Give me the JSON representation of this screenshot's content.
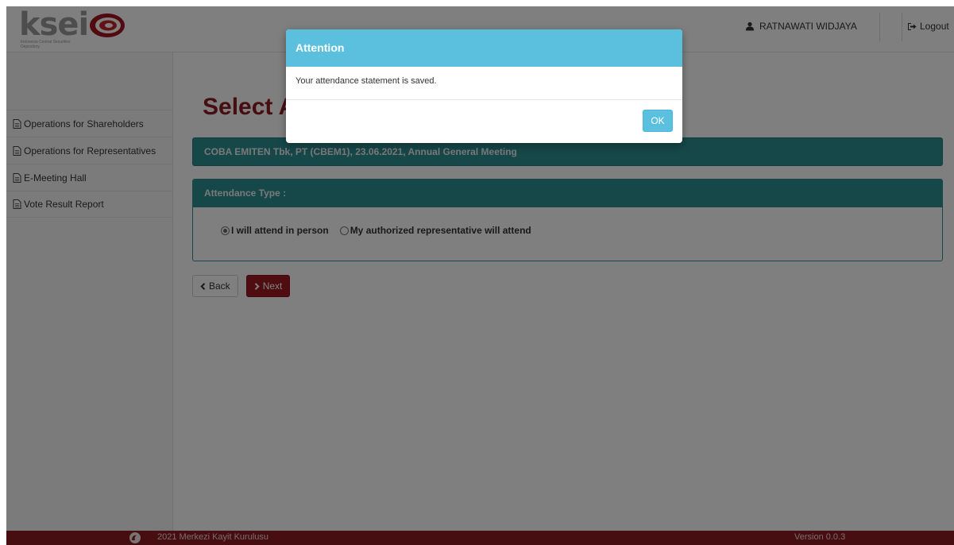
{
  "header": {
    "logo_text": "ksei",
    "logo_subtitle": "Indonesia Central Securities Depository",
    "user_name": "RATNAWATI WIDJAYA",
    "logout_label": "Logout"
  },
  "sidebar": {
    "items": [
      {
        "label": "Operations for Shareholders",
        "icon": "document-icon"
      },
      {
        "label": "Operations for Representatives",
        "icon": "document-icon"
      },
      {
        "label": "E-Meeting Hall",
        "icon": "document-icon"
      },
      {
        "label": "Vote Result Report",
        "icon": "document-icon"
      }
    ]
  },
  "main": {
    "title": "Select A",
    "event": "COBA EMITEN Tbk, PT (CBEM1), 23.06.2021, Annual General Meeting",
    "attendance_header": "Attendance Type :",
    "options": [
      {
        "label": "I will attend in person",
        "selected": true
      },
      {
        "label": "My authorized representative will attend",
        "selected": false
      }
    ],
    "back_label": "Back",
    "next_label": "Next"
  },
  "footer": {
    "copyright": "2021 Merkezi Kayit Kurulusu",
    "version": "Version 0.0.3"
  },
  "modal": {
    "title": "Attention",
    "message": "Your attendance statement is saved.",
    "ok_label": "OK"
  },
  "colors": {
    "brand_red": "#8e1d25",
    "teal": "#2c8f93",
    "modal_blue": "#5bc0de"
  }
}
